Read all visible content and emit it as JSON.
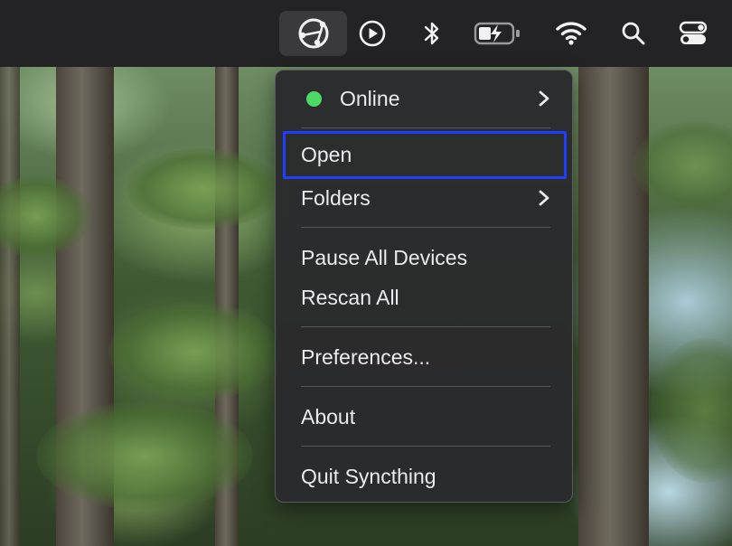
{
  "menu_bar": {
    "icons": [
      {
        "name": "syncthing-icon",
        "active": true
      },
      {
        "name": "play-circle-icon"
      },
      {
        "name": "bluetooth-icon"
      },
      {
        "name": "battery-charging-icon"
      },
      {
        "name": "wifi-icon"
      },
      {
        "name": "search-icon"
      },
      {
        "name": "control-center-icon"
      }
    ]
  },
  "menu": {
    "status": {
      "label": "Online",
      "color": "#4cd964"
    },
    "items": {
      "open": "Open",
      "folders": "Folders",
      "pause_all": "Pause All Devices",
      "rescan_all": "Rescan All",
      "preferences": "Preferences...",
      "about": "About",
      "quit": "Quit Syncthing"
    },
    "highlight_color": "#1f3fff"
  }
}
